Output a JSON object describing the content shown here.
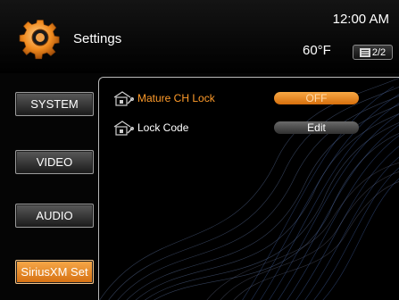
{
  "header": {
    "title": "Settings",
    "time": "12:00 AM",
    "temperature": "60°F",
    "page_indicator": "2/2"
  },
  "sidebar": {
    "items": [
      {
        "label": "SYSTEM",
        "active": false
      },
      {
        "label": "VIDEO",
        "active": false
      },
      {
        "label": "AUDIO",
        "active": false
      },
      {
        "label": "SiriusXM Set",
        "active": true
      }
    ]
  },
  "settings": {
    "rows": [
      {
        "label": "Mature CH Lock",
        "value": "OFF",
        "icon": "lock-icon",
        "highlighted": true
      },
      {
        "label": "Lock Code",
        "value": "Edit",
        "icon": "lock-icon",
        "highlighted": false
      }
    ]
  },
  "colors": {
    "accent": "#f08a1e",
    "highlight_text": "#ff9b2a",
    "background": "#000000"
  }
}
